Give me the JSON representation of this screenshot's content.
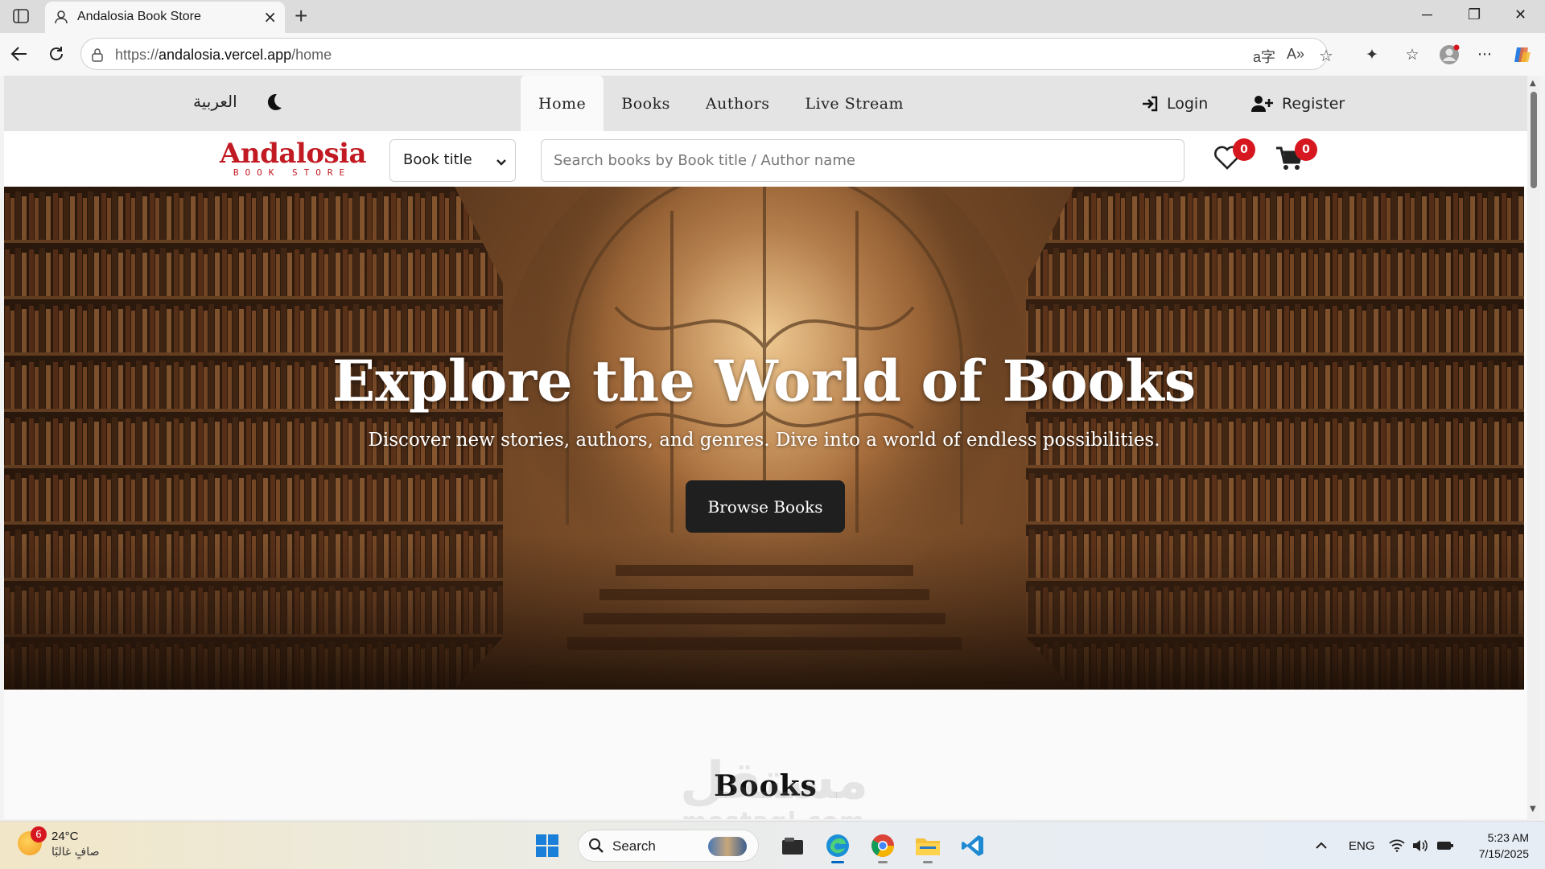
{
  "browser": {
    "tab_title": "Andalosia Book Store",
    "url_prefix": "https://",
    "url_host": "andalosia.vercel.app",
    "url_path": "/home"
  },
  "topnav": {
    "language_label": "العربية",
    "links": [
      {
        "label": "Home",
        "active": true
      },
      {
        "label": "Books",
        "active": false
      },
      {
        "label": "Authors",
        "active": false
      },
      {
        "label": "Live Stream",
        "active": false
      }
    ],
    "login_label": "Login",
    "register_label": "Register"
  },
  "header": {
    "logo_text": "Andalosia",
    "logo_subtext": "BOOK STORE",
    "select_value": "Book title",
    "search_placeholder": "Search books by Book title / Author name",
    "wishlist_count": "0",
    "cart_count": "0"
  },
  "hero": {
    "title": "Explore the World of Books",
    "subtitle": "Discover new stories, authors, and genres. Dive into a world of endless possibilities.",
    "button_label": "Browse Books"
  },
  "section": {
    "title": "Books"
  },
  "watermark": {
    "arabic": "مستقل",
    "latin": "mostaql.com"
  },
  "taskbar": {
    "weather_temp": "24°C",
    "weather_condition": "صافٍ غالبًا",
    "weather_badge": "6",
    "search_label": "Search",
    "language": "ENG",
    "time": "5:23 AM",
    "date": "7/15/2025"
  },
  "colors": {
    "brand_red": "#c21a23",
    "badge_red": "#d6171f",
    "button_dark": "#1f1f1f",
    "nav_bg": "#e4e4e4"
  }
}
